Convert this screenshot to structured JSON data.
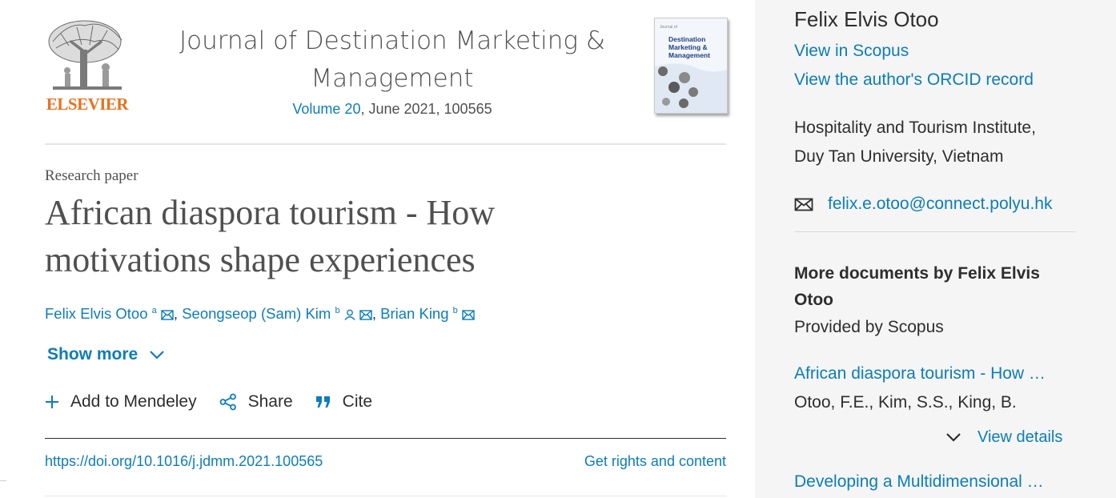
{
  "publisher": {
    "wordmark": "ELSEVIER",
    "logo_icon": "tree-logo-icon"
  },
  "journal": {
    "title": "Journal of Destination Marketing & Management",
    "volume_link": "Volume 20",
    "issue_rest": ", June 2021, 100565",
    "cover_small": "Journal of",
    "cover_title": "Destination Marketing & Management"
  },
  "article": {
    "type": "Research paper",
    "title": "African diaspora tourism - How motivations shape experiences",
    "authors": [
      {
        "name": "Felix Elvis Otoo",
        "sup": "a",
        "separator": ","
      },
      {
        "name": "Seongseop (Sam) Kim",
        "sup": "b",
        "separator": ","
      },
      {
        "name": "Brian King",
        "sup": "b",
        "separator": ""
      }
    ],
    "show_more": "Show more",
    "actions": {
      "mendeley": "Add to Mendeley",
      "share": "Share",
      "cite": "Cite"
    },
    "doi": "https://doi.org/10.1016/j.jdmm.2021.100565",
    "rights": "Get rights and content"
  },
  "side_panel": {
    "author_name": "Felix Elvis Otoo",
    "view_scopus": "View in Scopus",
    "view_orcid": "View the author's ORCID record",
    "affiliation_line1": "Hospitality and Tourism Institute,",
    "affiliation_line2": "Duy Tan University, Vietnam",
    "email": "felix.e.otoo@connect.polyu.hk",
    "more_docs_title": "More documents by Felix Elvis Otoo",
    "provided_by": "Provided by Scopus",
    "documents": [
      {
        "title": "African diaspora tourism - How …",
        "authors": "Otoo, F.E., Kim, S.S., King, B."
      },
      {
        "title": "Developing a Multidimensional …"
      }
    ],
    "view_details": "View details"
  },
  "colors": {
    "link": "#0c7dbb",
    "publisher_orange": "#e9711c",
    "panel_background": "#f5f5f5",
    "text": "#2e2e2e"
  }
}
